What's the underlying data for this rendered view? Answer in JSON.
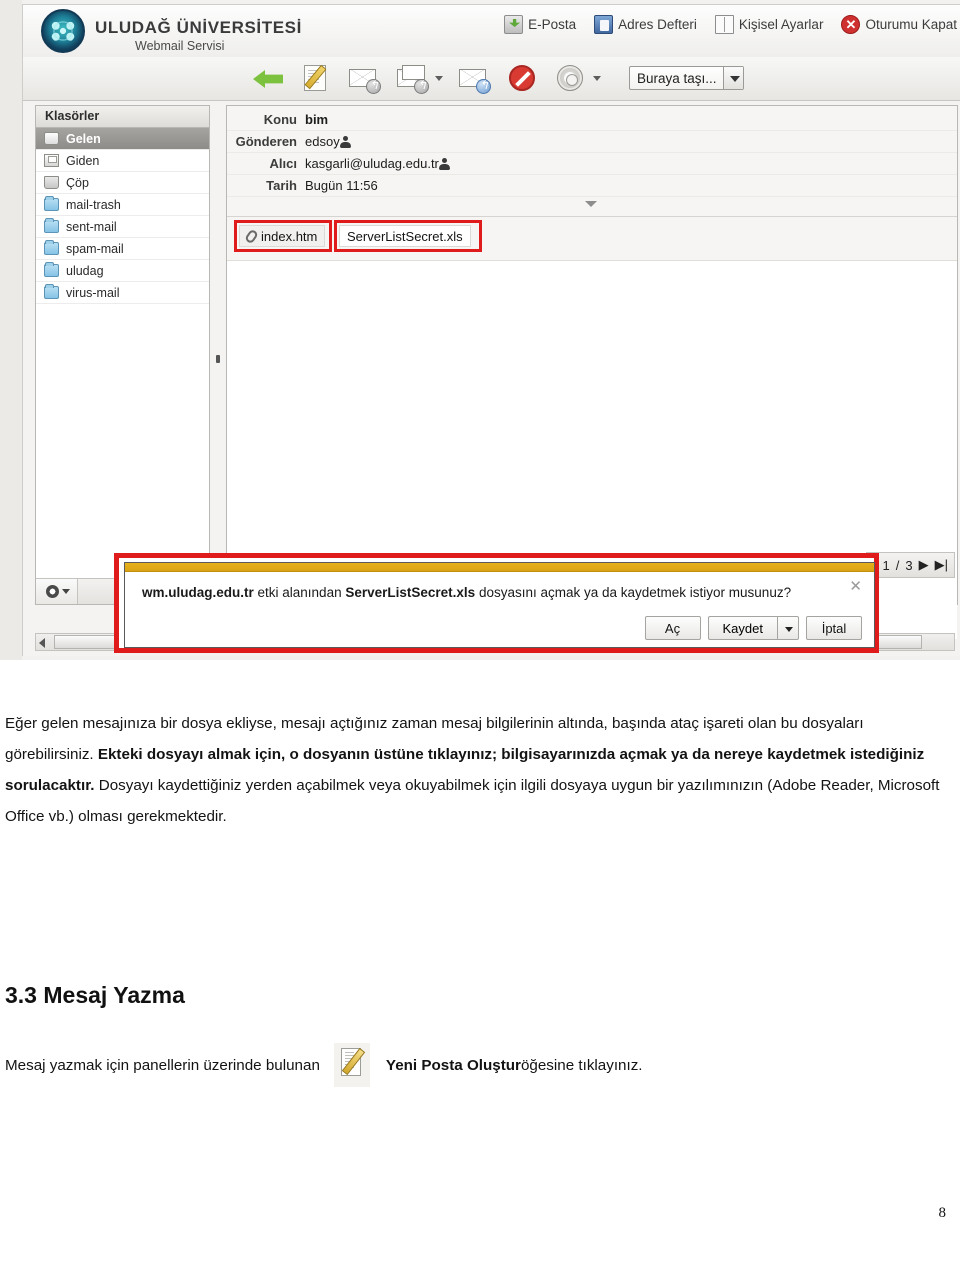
{
  "screenshot": {
    "brand": {
      "name": "ULUDAĞ ÜNİVERSİTESİ",
      "subtitle": "Webmail Servisi",
      "logo_icon": "university-seal-icon"
    },
    "topnav": [
      {
        "label": "E-Posta",
        "icon": "email-inbox-icon"
      },
      {
        "label": "Adres Defteri",
        "icon": "address-book-icon"
      },
      {
        "label": "Kişisel Ayarlar",
        "icon": "personal-settings-icon"
      },
      {
        "label": "Oturumu Kapat",
        "icon": "logout-icon"
      }
    ],
    "toolbar": {
      "buttons": [
        {
          "name": "back-button",
          "icon": "green-back-arrow-icon"
        },
        {
          "name": "compose-button",
          "icon": "compose-message-icon"
        },
        {
          "name": "reply-button",
          "icon": "reply-icon"
        },
        {
          "name": "reply-all-button",
          "icon": "reply-all-icon"
        },
        {
          "name": "forward-button",
          "icon": "forward-icon"
        },
        {
          "name": "spam-button",
          "icon": "block-spam-icon"
        },
        {
          "name": "settings-button",
          "icon": "gear-icon"
        }
      ],
      "move_to_label": "Buraya taşı...",
      "move_to_icon": "chevron-down-icon"
    },
    "folders": {
      "header": "Klasörler",
      "items": [
        {
          "label": "Gelen",
          "icon": "inbox-icon",
          "selected": true
        },
        {
          "label": "Giden",
          "icon": "outbox-icon",
          "selected": false
        },
        {
          "label": "Çöp",
          "icon": "trash-icon",
          "selected": false
        },
        {
          "label": "mail-trash",
          "icon": "folder-icon",
          "selected": false
        },
        {
          "label": "sent-mail",
          "icon": "folder-icon",
          "selected": false
        },
        {
          "label": "spam-mail",
          "icon": "folder-icon",
          "selected": false
        },
        {
          "label": "uludag",
          "icon": "folder-icon",
          "selected": false
        },
        {
          "label": "virus-mail",
          "icon": "folder-icon",
          "selected": false
        }
      ],
      "footer_icon": "gear-dropdown-icon"
    },
    "message": {
      "headers": [
        {
          "label": "Konu",
          "value": "bim"
        },
        {
          "label": "Gönderen",
          "value": "edsoy"
        },
        {
          "label": "Alıcı",
          "value": "kasgarli@uludag.edu.tr"
        },
        {
          "label": "Tarih",
          "value": "Bugün 11:56"
        }
      ],
      "attachments": [
        {
          "name": "index.htm",
          "icon": "paperclip-icon"
        },
        {
          "name": "ServerListSecret.xls",
          "icon": "none"
        }
      ]
    },
    "pagination": {
      "prefix": ":",
      "current": "1",
      "separator": "/",
      "total": "3",
      "next_icon": "next-page-icon",
      "last_icon": "last-page-icon"
    },
    "download_dialog": {
      "domain": "wm.uludag.edu.tr",
      "text_mid": " etki alanından ",
      "filename": "ServerListSecret.xls",
      "text_end": " dosyasını açmak ya da kaydetmek istiyor musunuz?",
      "close_label": "✕",
      "open_label": "Aç",
      "save_label": "Kaydet",
      "cancel_label": "İptal",
      "save_caret_icon": "chevron-down-icon"
    },
    "accent_colors": {
      "highlight_red": "#e01b1b",
      "dialog_strip_yellow": "#d9a313",
      "selected_folder_grey": "#8e8c88",
      "back_arrow_green": "#7dc23f"
    }
  },
  "document": {
    "paragraph": {
      "part1": "Eğer gelen mesajınıza bir dosya ekliyse, mesajı açtığınız zaman mesaj bilgilerinin altında, başında ataç işareti olan bu dosyaları görebilirsiniz. ",
      "part2_bold": "Ekteki dosyayı almak için, o dosyanın üstüne tıklayınız; bilgisayarınızda açmak ya da nereye kaydetmek istediğiniz sorulacaktır.",
      "part3": " Dosyayı kaydettiğiniz yerden açabilmek veya okuyabilmek için ilgili dosyaya uygun bir yazılımınızın (Adobe Reader, Microsoft Office vb.) olması gerekmektedir."
    },
    "heading": "3.3 Mesaj Yazma",
    "last_line": {
      "before": "Mesaj yazmak için panellerin üzerinde bulunan",
      "icon": "compose-message-icon",
      "bold": "Yeni Posta Oluştur",
      "after": " öğesine tıklayınız."
    },
    "page_number": "8"
  }
}
